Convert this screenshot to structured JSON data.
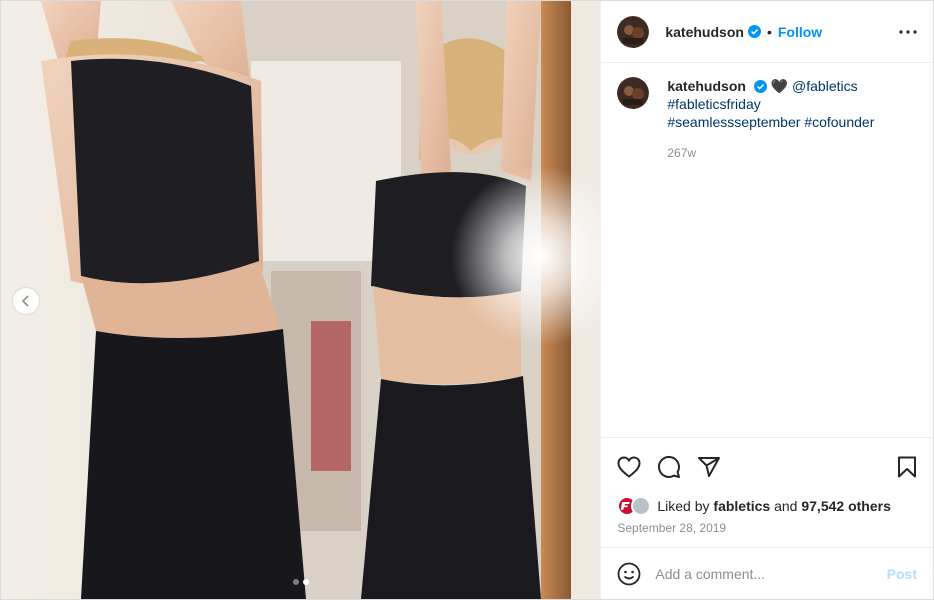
{
  "header": {
    "username": "katehudson",
    "separator": "•",
    "follow_label": "Follow"
  },
  "caption": {
    "username": "katehudson",
    "emoji": "🖤",
    "mention": "@fabletics",
    "hashtags_line1": "#fableticsfriday",
    "hashtags_line2": "#seamlessseptember #cofounder",
    "age": "267w"
  },
  "likes": {
    "prefix": "Liked by",
    "user": "fabletics",
    "joiner": "and",
    "others": "97,542 others"
  },
  "date": "September 28, 2019",
  "comment": {
    "placeholder": "Add a comment...",
    "post_label": "Post"
  },
  "carousel": {
    "slide_count": 2,
    "active_index": 1
  },
  "colors": {
    "link": "#00376b",
    "follow": "#0095f6",
    "verified": "#0095f6",
    "post_disabled": "#b2dffc"
  },
  "icons": [
    "verified-badge-icon",
    "more-options-icon",
    "heart-icon",
    "comment-icon",
    "share-icon",
    "bookmark-icon",
    "emoji-icon",
    "chevron-left-icon"
  ]
}
